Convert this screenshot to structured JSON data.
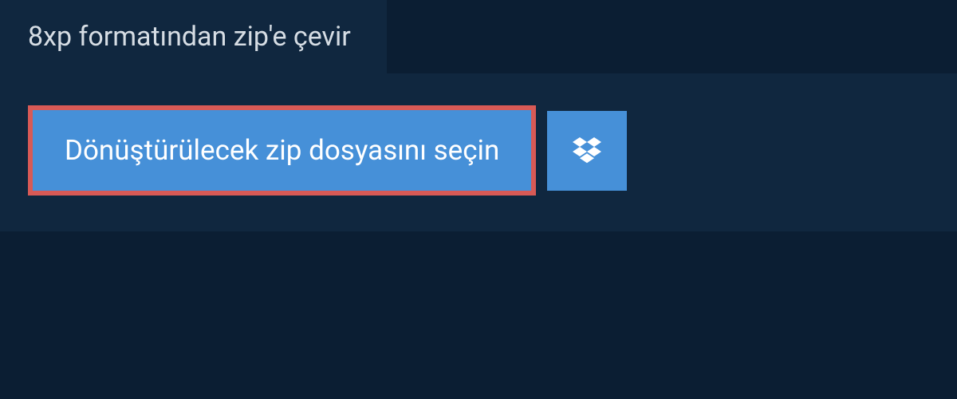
{
  "tab": {
    "title": "8xp formatından zip'e çevir"
  },
  "panel": {
    "select_button_label": "Dönüştürülecek zip dosyasını seçin"
  },
  "colors": {
    "page_bg": "#0b1e33",
    "panel_bg": "#10273f",
    "button_bg": "#4690d8",
    "highlight_border": "#d85a56"
  }
}
